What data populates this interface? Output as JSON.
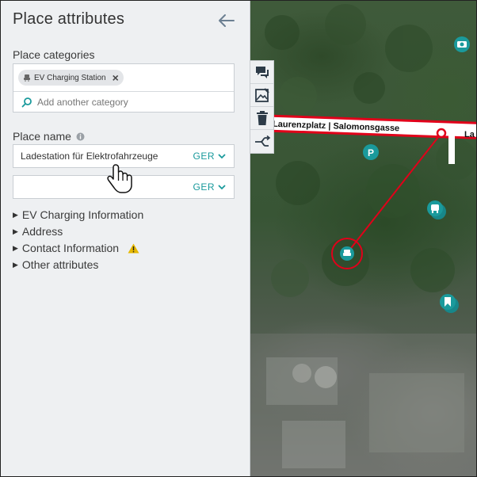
{
  "panel": {
    "title": "Place attributes",
    "categories_label": "Place categories",
    "category_chip": "EV Charging Station",
    "add_category_placeholder": "Add another category",
    "name_label": "Place name",
    "name_value": "Ladestation für Elektrofahrzeuge",
    "name_lang": "GER",
    "second_name_value": "",
    "second_lang": "GER",
    "expanders": [
      {
        "label": "EV Charging Information"
      },
      {
        "label": "Address"
      },
      {
        "label": "Contact Information",
        "warning": true
      },
      {
        "label": "Other attributes"
      }
    ]
  },
  "map": {
    "street_label": "Laurenzplatz | Salomonsgasse",
    "street_label_right": "La",
    "icons": [
      "camera-poi-icon",
      "parking-poi-icon",
      "ev-charging-poi-icon",
      "transit-poi-icon",
      "bookmark-poi-icon"
    ]
  },
  "toolbar": {
    "tools": [
      "comment-icon",
      "image-edit-icon",
      "trash-icon",
      "route-split-icon"
    ]
  },
  "colors": {
    "accent": "#1a9a9c",
    "warning": "#e6b800",
    "route": "#e1001a"
  }
}
